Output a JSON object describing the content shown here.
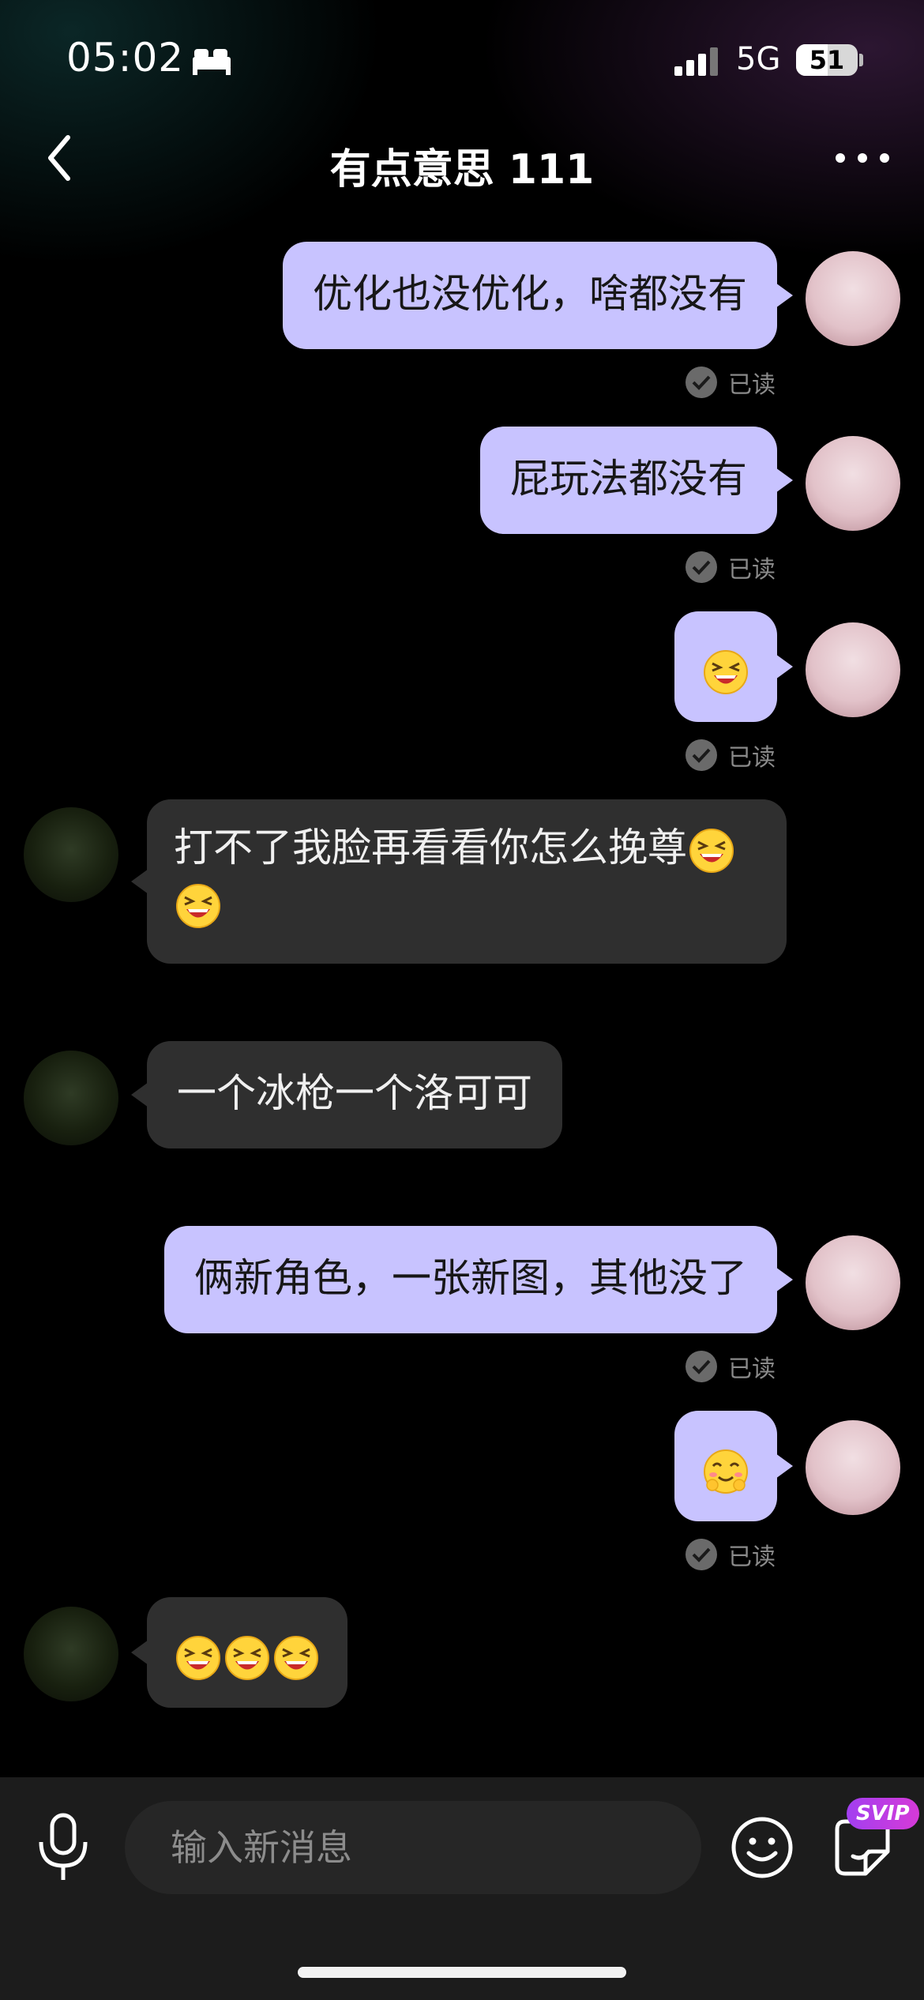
{
  "status_bar": {
    "time": "05:02",
    "network": "5G",
    "battery": "51",
    "battery_level_percent": 51
  },
  "header": {
    "title": "有点意思 111",
    "back_icon": "chevron-left-icon",
    "more_icon": "more-dots-icon"
  },
  "messages": [
    {
      "sender": "me",
      "text": "优化也没优化，啥都没有",
      "status": "已读"
    },
    {
      "sender": "me",
      "text": "屁玩法都没有",
      "status": "已读"
    },
    {
      "sender": "me",
      "emoji": [
        "laughing-face"
      ],
      "status": "已读"
    },
    {
      "sender": "other",
      "text": "打不了我脸再看看你怎么挽尊",
      "emoji": [
        "laughing-face",
        "laughing-face"
      ]
    },
    {
      "sender": "other",
      "text": "一个冰枪一个洛可可"
    },
    {
      "sender": "me",
      "text": "俩新角色，一张新图，其他没了",
      "status": "已读"
    },
    {
      "sender": "me",
      "emoji": [
        "blushing-smile-face"
      ],
      "status": "已读"
    },
    {
      "sender": "other",
      "emoji": [
        "laughing-face",
        "laughing-face",
        "laughing-face"
      ]
    }
  ],
  "input_bar": {
    "placeholder": "输入新消息",
    "badge": "SVIP",
    "icons": [
      "microphone-icon",
      "smiley-icon",
      "sticker-icon"
    ]
  },
  "colors": {
    "my_bubble": "#c8c3ff",
    "other_bubble": "#2f2f2f",
    "background": "#000000",
    "svip_badge": "#b83ee6"
  }
}
